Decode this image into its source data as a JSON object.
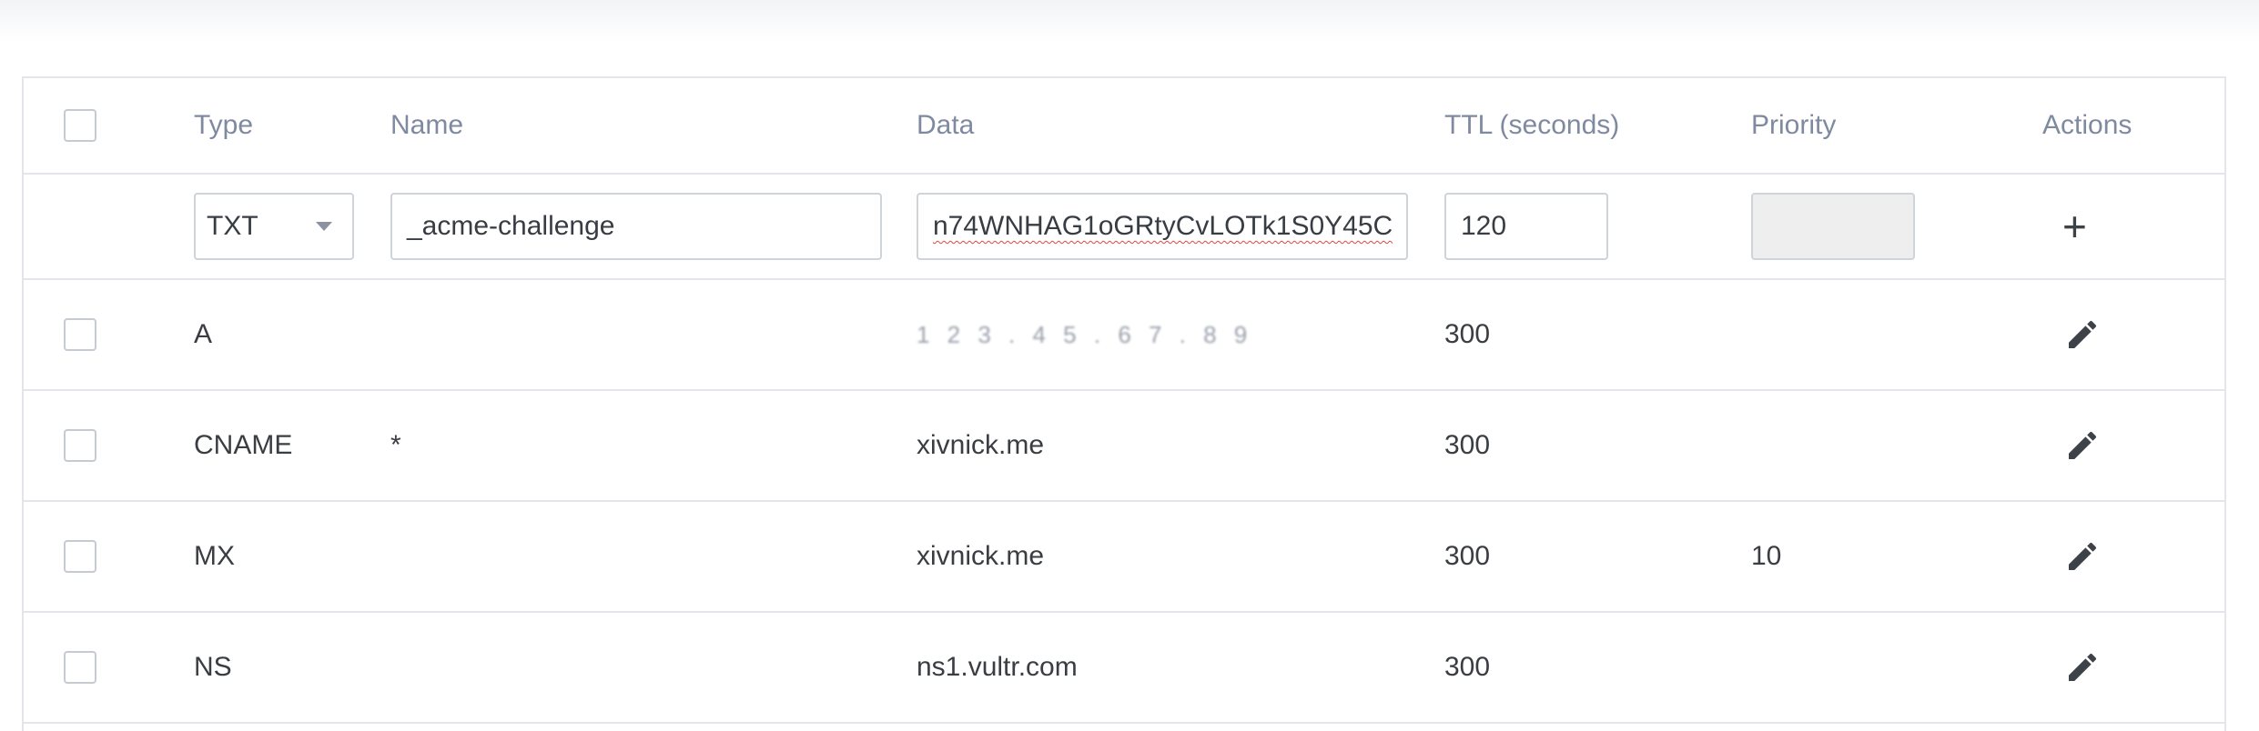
{
  "columns": {
    "type": "Type",
    "name": "Name",
    "data": "Data",
    "ttl": "TTL (seconds)",
    "priority": "Priority",
    "actions": "Actions"
  },
  "new_record": {
    "type": "TXT",
    "name": "_acme-challenge",
    "data": "n74WNHAG1oGRtyCvLOTk1S0Y45C",
    "ttl": "120",
    "priority": "",
    "add_label": "+"
  },
  "records": [
    {
      "type": "A",
      "name": "",
      "data": "1 2 3 . 4 5 . 6 7 . 8 9",
      "ttl": "300",
      "priority": ""
    },
    {
      "type": "CNAME",
      "name": "*",
      "data": "xivnick.me",
      "ttl": "300",
      "priority": ""
    },
    {
      "type": "MX",
      "name": "",
      "data": "xivnick.me",
      "ttl": "300",
      "priority": "10"
    },
    {
      "type": "NS",
      "name": "",
      "data": "ns1.vultr.com",
      "ttl": "300",
      "priority": ""
    }
  ],
  "icons": {
    "edit": "pencil-icon",
    "add": "plus-icon",
    "dropdown": "chevron-down-icon"
  },
  "colors": {
    "header_text": "#7f8aa0",
    "border": "#e3e5ea",
    "disabled_field": "#eeeeee"
  }
}
